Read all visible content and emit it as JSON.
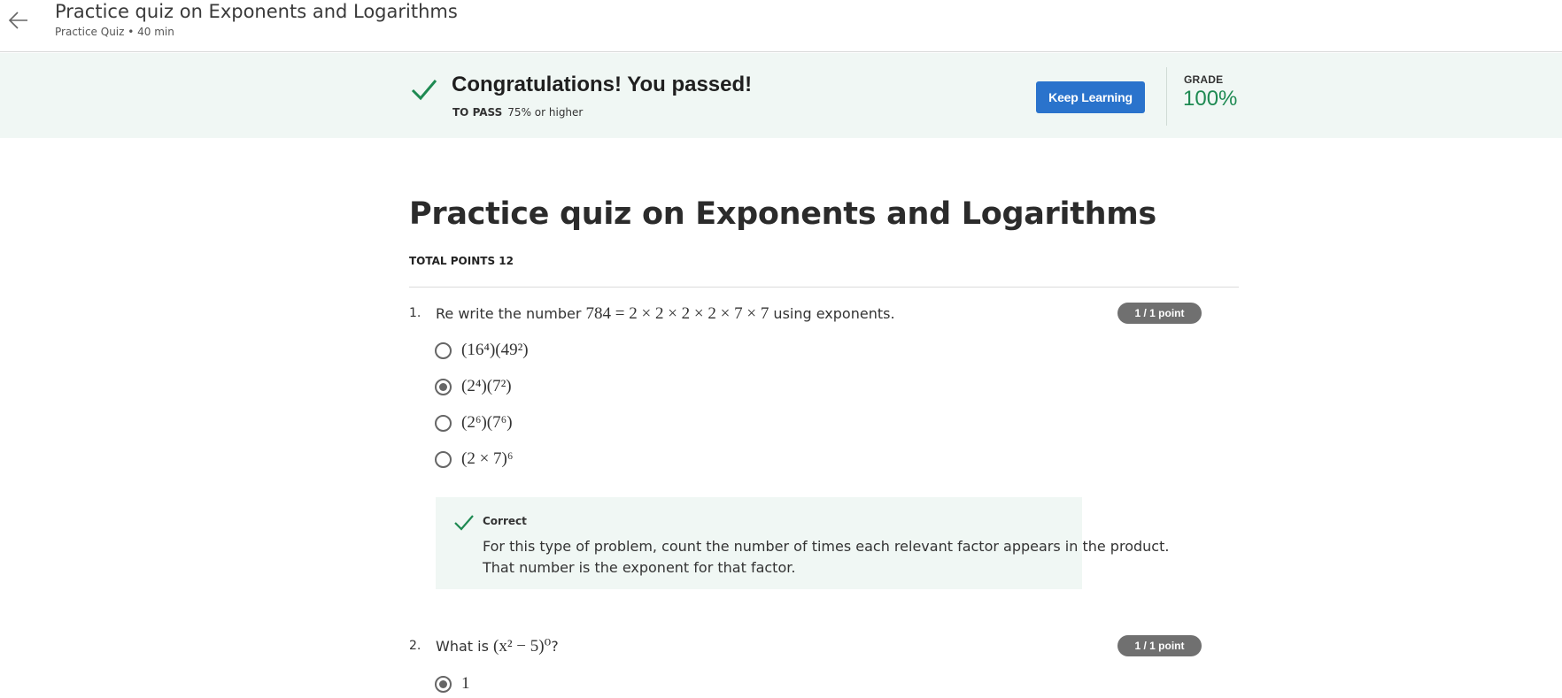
{
  "header": {
    "title": "Practice quiz on Exponents and Logarithms",
    "subtitle": "Practice Quiz • 40 min",
    "back_icon": "arrow-left-icon"
  },
  "banner": {
    "title": "Congratulations! You passed!",
    "to_pass_label": "TO PASS",
    "to_pass_value": "75% or higher",
    "keep_learning": "Keep Learning",
    "grade_label": "GRADE",
    "grade_value": "100%",
    "accent": "#1e8a52",
    "button_color": "#2a73cc"
  },
  "quiz": {
    "title": "Practice quiz on Exponents and Logarithms",
    "total_points": "TOTAL POINTS 12"
  },
  "questions": [
    {
      "number": "1.",
      "prefix": "Re write the number",
      "math": "784 = 2 × 2 × 2 × 2 × 7 × 7",
      "suffix": "using exponents.",
      "points": "1 / 1 point",
      "options": [
        {
          "label": "(16⁴)(49²)",
          "selected": false
        },
        {
          "label": "(2⁴)(7²)",
          "selected": true
        },
        {
          "label": "(2⁶)(7⁶)",
          "selected": false
        },
        {
          "label": "(2 × 7)⁶",
          "selected": false
        }
      ],
      "feedback": {
        "title": "Correct",
        "line1": "For this type of problem, count the number of times each relevant factor appears in the product.",
        "line2": "That number is the exponent for that factor."
      }
    },
    {
      "number": "2.",
      "prefix": "What is",
      "math": "(x² − 5)⁰",
      "suffix": "?",
      "points": "1 / 1 point",
      "options": [
        {
          "label": "1",
          "selected": true
        }
      ]
    }
  ]
}
